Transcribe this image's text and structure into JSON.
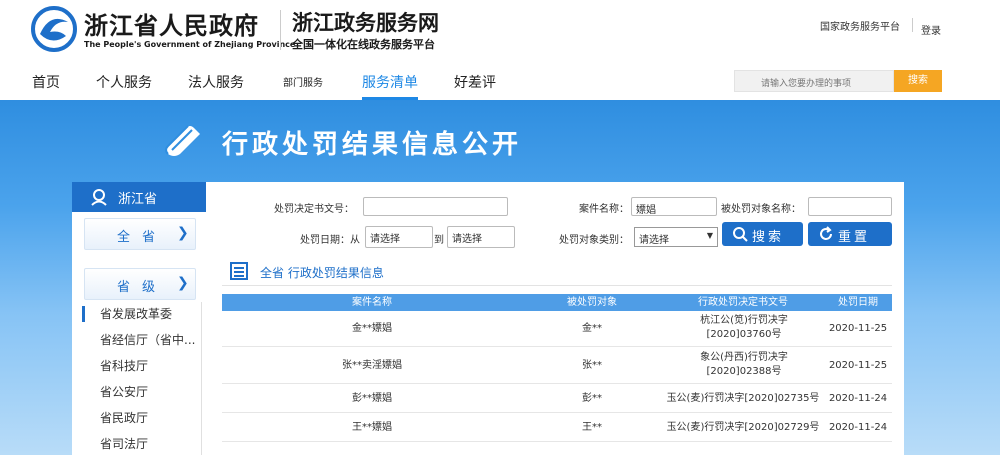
{
  "header": {
    "gov_title": "浙江省人民政府",
    "gov_subtitle": "The People's Government of Zhejiang Province",
    "site_title": "浙江政务服务网",
    "site_subtitle": "全国一体化在线政务服务平台",
    "national_link": "国家政务服务平台",
    "login_link": "登录"
  },
  "nav": {
    "items": [
      "首页",
      "个人服务",
      "法人服务",
      "部门服务",
      "服务清单",
      "好差评"
    ],
    "active_index": 4,
    "search_placeholder": "请输入您要办理的事项",
    "search_button": "搜索"
  },
  "banner": {
    "title": "行政处罚结果信息公开"
  },
  "sidebar": {
    "region": "浙江省",
    "all_province": "全省",
    "provincial": "省级",
    "departments": [
      "省发展改革委",
      "省经信厅（省中...",
      "省科技厅",
      "省公安厅",
      "省民政厅",
      "省司法厅"
    ],
    "active_index": 0
  },
  "filters": {
    "decision_no_label": "处罚决定书文号：",
    "decision_no_value": "",
    "case_name_label": "案件名称：",
    "case_name_value": "嫖娼",
    "target_name_label": "被处罚对象名称：",
    "target_name_value": "",
    "date_label": "处罚日期：从",
    "date_from_placeholder": "请选择",
    "date_to_label": "到",
    "date_to_placeholder": "请选择",
    "target_type_label": "处罚对象类别：",
    "target_type_value": "请选择",
    "search_button": "搜索",
    "reset_button": "重置"
  },
  "results": {
    "section_title": "全省 行政处罚结果信息",
    "columns": [
      "案件名称",
      "被处罚对象",
      "行政处罚决定书文号",
      "处罚日期"
    ],
    "rows": [
      {
        "case": "金**嫖娼",
        "target": "金**",
        "doc_no": "杭江公(笕)行罚决字[2020]03760号",
        "date": "2020-11-25"
      },
      {
        "case": "张**卖淫嫖娼",
        "target": "张**",
        "doc_no": "象公(丹西)行罚决字[2020]02388号",
        "date": "2020-11-25"
      },
      {
        "case": "彭**嫖娼",
        "target": "彭**",
        "doc_no": "玉公(麦)行罚决字[2020]02735号",
        "date": "2020-11-24"
      },
      {
        "case": "王**嫖娼",
        "target": "王**",
        "doc_no": "玉公(麦)行罚决字[2020]02729号",
        "date": "2020-11-24"
      }
    ]
  },
  "colors": {
    "primary": "#1e6fc9",
    "accent_orange": "#f5a623",
    "table_header": "#4f9de6"
  }
}
